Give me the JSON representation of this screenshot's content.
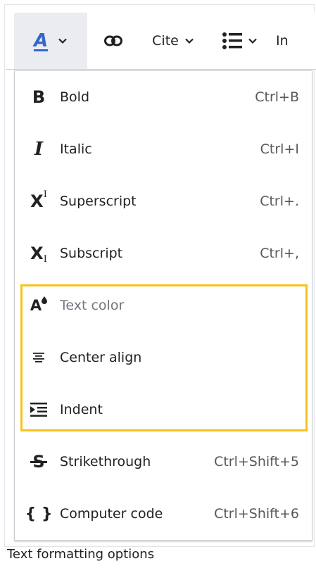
{
  "toolbar": {
    "style_icon": "A",
    "style_icon_name": "text-style-icon",
    "link_icon_name": "link-icon",
    "cite_label": "Cite",
    "list_icon_name": "bullet-list-icon",
    "insert_label": "In"
  },
  "menu": {
    "items": [
      {
        "icon": "B",
        "label": "Bold",
        "shortcut": "Ctrl+B"
      },
      {
        "icon": "I",
        "label": "Italic",
        "shortcut": "Ctrl+I"
      },
      {
        "icon": "X",
        "icon_sup": "I",
        "label": "Superscript",
        "shortcut": "Ctrl+."
      },
      {
        "icon": "X",
        "icon_sub": "I",
        "label": "Subscript",
        "shortcut": "Ctrl+,"
      },
      {
        "icon": "A",
        "label": "Text color",
        "shortcut": "",
        "disabled": true
      },
      {
        "icon": "≡",
        "label": "Center align",
        "shortcut": ""
      },
      {
        "icon": "indent",
        "label": "Indent",
        "shortcut": ""
      },
      {
        "icon": "S",
        "label": "Strikethrough",
        "shortcut": "Ctrl+Shift+5"
      },
      {
        "icon": "{ }",
        "label": "Computer code",
        "shortcut": "Ctrl+Shift+6"
      }
    ]
  },
  "highlight_color": "#f7c31b",
  "accent_color": "#3366cc",
  "caption": "Text formatting options"
}
